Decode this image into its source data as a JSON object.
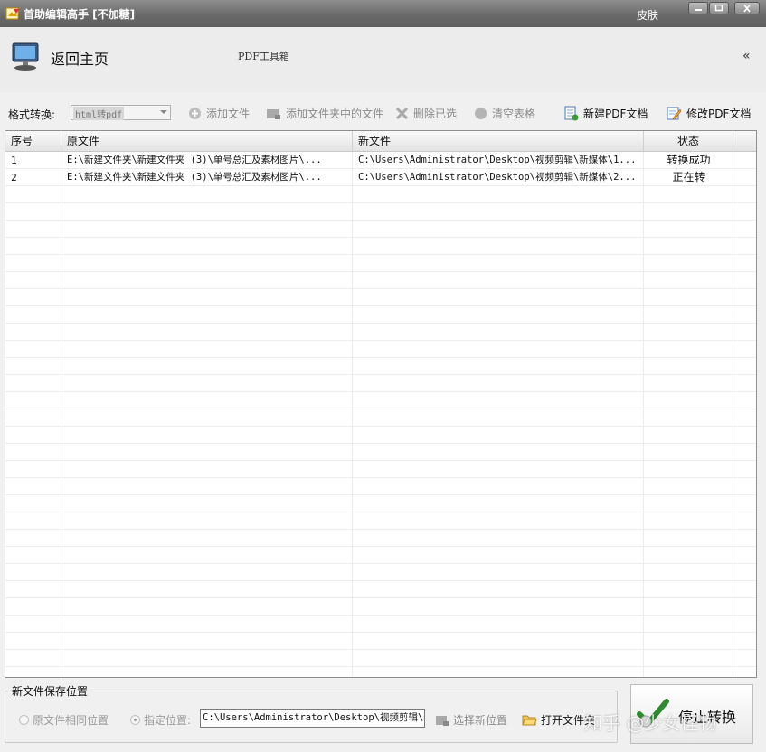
{
  "window": {
    "title": "首助编辑高手 [不加糖]",
    "skin_label": "皮肤"
  },
  "header": {
    "home_label": "返回主页",
    "toolbox_label": "PDF工具箱",
    "collapse_label": "«"
  },
  "toolbar": {
    "format_label": "格式转换:",
    "format_value": "html转pdf",
    "add_file": "添加文件",
    "add_folder_files": "添加文件夹中的文件",
    "delete_selected": "删除已选",
    "clear_table": "清空表格",
    "new_pdf": "新建PDF文档",
    "edit_pdf": "修改PDF文档"
  },
  "table": {
    "columns": [
      "序号",
      "原文件",
      "新文件",
      "状态"
    ],
    "rows": [
      {
        "index": "1",
        "source": "E:\\新建文件夹\\新建文件夹 (3)\\单号总汇及素材图片\\...",
        "target": "C:\\Users\\Administrator\\Desktop\\视频剪辑\\新媒体\\1...",
        "status": "转换成功"
      },
      {
        "index": "2",
        "source": "E:\\新建文件夹\\新建文件夹 (3)\\单号总汇及素材图片\\...",
        "target": "C:\\Users\\Administrator\\Desktop\\视频剪辑\\新媒体\\2...",
        "status": "正在转"
      }
    ]
  },
  "save": {
    "group_title": "新文件保存位置",
    "same_location": "原文件相同位置",
    "specified_location": "指定位置:",
    "path": "C:\\Users\\Administrator\\Desktop\\视频剪辑\\新",
    "choose_location": "选择新位置",
    "open_folder": "打开文件夹"
  },
  "actions": {
    "stop_convert": "停止转换"
  },
  "watermark": "知乎 @少女怪物",
  "colors": {
    "titlebar": "#6a6a6a",
    "grid_line": "#ececec",
    "disabled_text": "#8a8a8a"
  }
}
